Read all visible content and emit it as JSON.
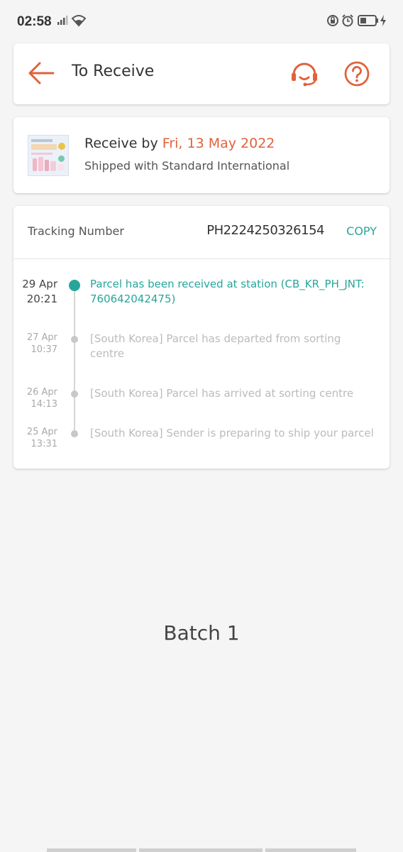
{
  "status_bar": {
    "time": "02:58",
    "icons": [
      "signal-icon",
      "wifi-icon",
      "lock-rotation-icon",
      "alarm-icon",
      "battery-icon",
      "charging-icon"
    ]
  },
  "header": {
    "title": "To Receive",
    "back_icon": "arrow-left-icon",
    "support_icon": "headset-icon",
    "help_icon": "question-icon"
  },
  "shipment": {
    "receive_prefix": "Receive by",
    "receive_date": "Fri, 13 May 2022",
    "shipped_with": "Shipped with Standard International"
  },
  "tracking": {
    "label": "Tracking Number",
    "number": "PH2224250326154",
    "copy_label": "COPY",
    "events": [
      {
        "date": "29 Apr",
        "time": "20:21",
        "text": "Parcel has been received at station (CB_KR_PH_JNT: 760642042475)",
        "active": true
      },
      {
        "date": "27 Apr",
        "time": "10:37",
        "text": "[South Korea] Parcel has departed from  sorting centre",
        "active": false
      },
      {
        "date": "26 Apr",
        "time": "14:13",
        "text": "[South Korea] Parcel has arrived at  sorting centre",
        "active": false
      },
      {
        "date": "25 Apr",
        "time": "13:31",
        "text": "[South Korea] Sender is preparing to ship your parcel",
        "active": false
      }
    ]
  },
  "batch_label": "Batch 1",
  "colors": {
    "accent": "#e0623c",
    "teal": "#26a69a",
    "background": "#f5f5f5"
  }
}
